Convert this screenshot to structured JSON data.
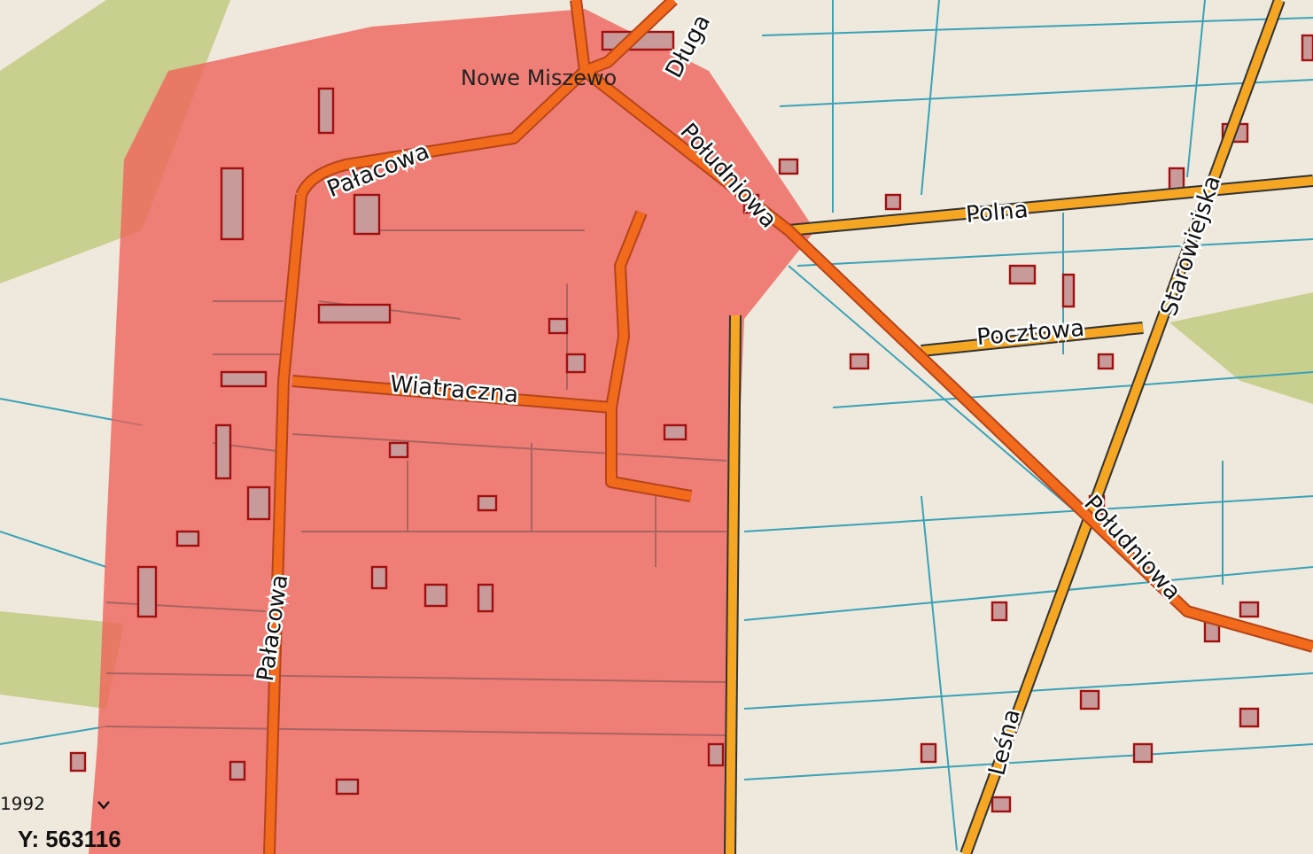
{
  "map": {
    "place_label": "Nowe Miszewo",
    "street_labels": [
      {
        "text": "Długa"
      },
      {
        "text": "Południowa"
      },
      {
        "text": "Pałacowa"
      },
      {
        "text": "Polna"
      },
      {
        "text": "Starowiejska"
      },
      {
        "text": "Pocztowa"
      },
      {
        "text": "Wiatraczna"
      },
      {
        "text": "Południowa"
      },
      {
        "text": "Pałacowa"
      },
      {
        "text": "Leśna"
      }
    ]
  },
  "projection_select": {
    "value": "1992"
  },
  "coordinate_readout": "Y: 563116"
}
